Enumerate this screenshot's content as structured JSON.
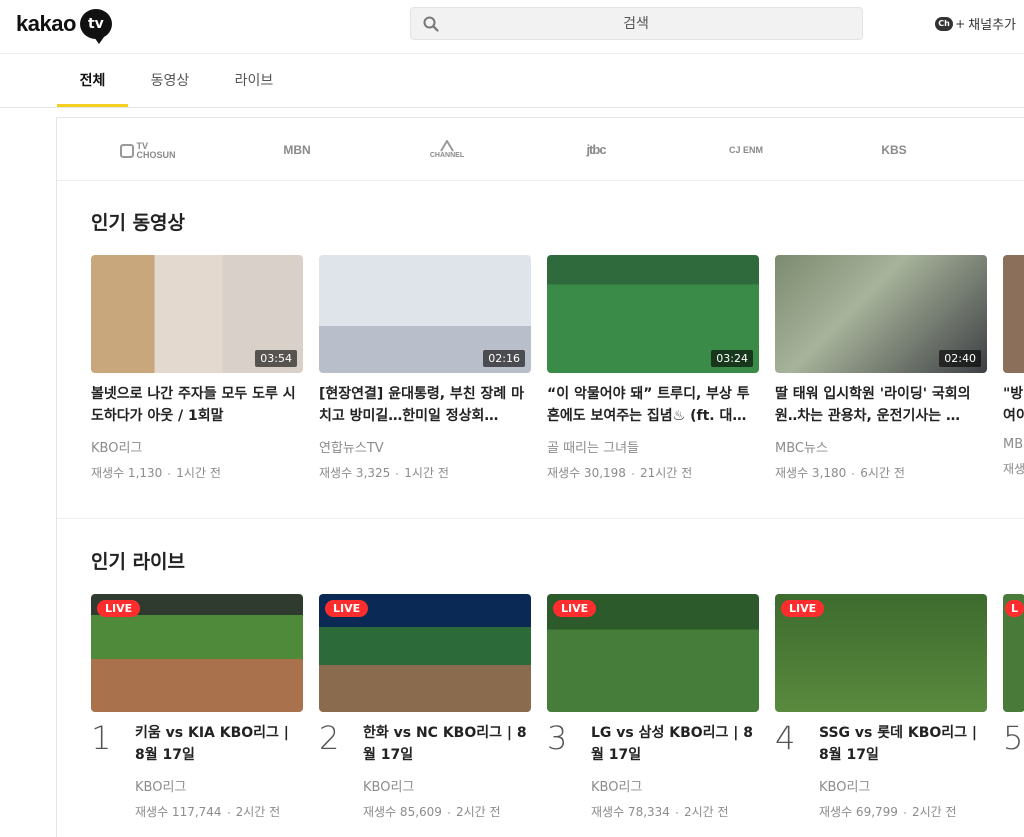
{
  "header": {
    "logo_text": "kakao",
    "logo_badge": "tv",
    "search_placeholder": "검색",
    "add_channel_icon": "Ch",
    "add_channel_plus": "+",
    "add_channel_label": "채널추가"
  },
  "tabs": [
    {
      "label": "전체",
      "active": true
    },
    {
      "label": "동영상",
      "active": false
    },
    {
      "label": "라이브",
      "active": false
    }
  ],
  "channel_logos": [
    "CHOSUN",
    "MBN",
    "CHANNEL A",
    "jtbc",
    "CJ ENM",
    "KBS"
  ],
  "channel_logo_small": {
    "tv": "TV",
    "chosun": "CHOSUN",
    "channel_a": "CHANNEL"
  },
  "popular_videos": {
    "title": "인기 동영상",
    "items": [
      {
        "duration": "03:54",
        "title": "볼넷으로 나간 주자들 모두 도루 시도하다가 아웃 / 1회말",
        "channel": "KBO리그",
        "views": "재생수 1,130",
        "time": "1시간 전"
      },
      {
        "duration": "02:16",
        "title": "[현장연결] 윤대통령, 부친 장례 마치고 방미길…한미일 정상회…",
        "channel": "연합뉴스TV",
        "views": "재생수 3,325",
        "time": "1시간 전"
      },
      {
        "duration": "03:24",
        "title": "“이 악물어야 돼” 트루디, 부상 투혼에도 보여주는 집념♨ (ft. 대…",
        "channel": "골 때리는 그녀들",
        "views": "재생수 30,198",
        "time": "21시간 전"
      },
      {
        "duration": "02:40",
        "title": "딸 태워 입시학원 '라이딩' 국회의원‥차는 관용차, 운전기사는 …",
        "channel": "MBC뉴스",
        "views": "재생수 3,180",
        "time": "6시간 전"
      }
    ],
    "partial": {
      "title_l1": "\"방",
      "title_l2": "여이",
      "channel": "MB",
      "views": "재생"
    }
  },
  "popular_live": {
    "title": "인기 라이브",
    "live_label": "LIVE",
    "items": [
      {
        "rank": "1",
        "title": "키움 vs KIA KBO리그 | 8월 17일",
        "channel": "KBO리그",
        "views": "재생수 117,744",
        "time": "2시간 전"
      },
      {
        "rank": "2",
        "title": "한화 vs NC KBO리그 | 8월 17일",
        "channel": "KBO리그",
        "views": "재생수 85,609",
        "time": "2시간 전"
      },
      {
        "rank": "3",
        "title": "LG vs 삼성 KBO리그 | 8월 17일",
        "channel": "KBO리그",
        "views": "재생수 78,334",
        "time": "2시간 전"
      },
      {
        "rank": "4",
        "title": "SSG vs 롯데 KBO리그 | 8월 17일",
        "channel": "KBO리그",
        "views": "재생수 69,799",
        "time": "2시간 전"
      }
    ],
    "partial_rank": "5",
    "partial_live": "L"
  }
}
